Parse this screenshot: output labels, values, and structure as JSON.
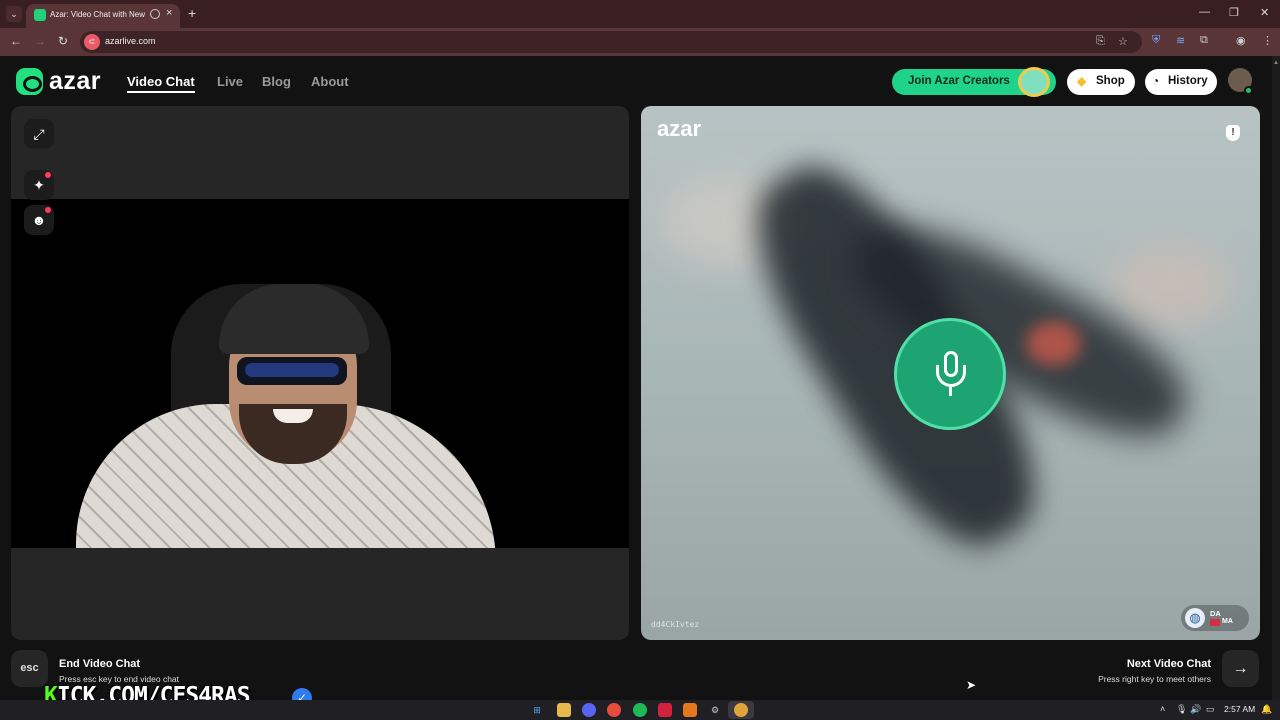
{
  "browser": {
    "tab_title": "Azar: Video Chat with New",
    "url": "azarlive.com",
    "icons": [
      "back-icon",
      "forward-icon",
      "reload-icon",
      "install-icon",
      "star-icon",
      "shield-extension-icon",
      "wave-extension-icon",
      "extensions-icon",
      "profile-icon",
      "menu-icon"
    ]
  },
  "header": {
    "logo": "azar",
    "nav": [
      {
        "label": "Video Chat",
        "active": true
      },
      {
        "label": "Live",
        "active": false
      },
      {
        "label": "Blog",
        "active": false
      },
      {
        "label": "About",
        "active": false
      }
    ],
    "creators_label": "Join Azar Creators",
    "shop_label": "Shop",
    "history_label": "History"
  },
  "right_panel": {
    "logo": "azar",
    "partner_id": "dd4CkIvtez",
    "location_code": "DA",
    "country_code": "MA"
  },
  "controls": {
    "esc_key": "esc",
    "end_title": "End Video Chat",
    "end_sub": "Press esc key to end video chat",
    "next_title": "Next Video Chat",
    "next_sub": "Press right key to meet others"
  },
  "overlay": {
    "kick_k": "K",
    "kick_rest": "ICK.COM/CES4RAS"
  },
  "taskbar": {
    "time": "2:57 AM"
  },
  "colors": {
    "brand_green": "#23e07f",
    "mic_green": "#1ea472",
    "kick_green": "#53fc18",
    "notify_red": "#ff3b5b"
  }
}
